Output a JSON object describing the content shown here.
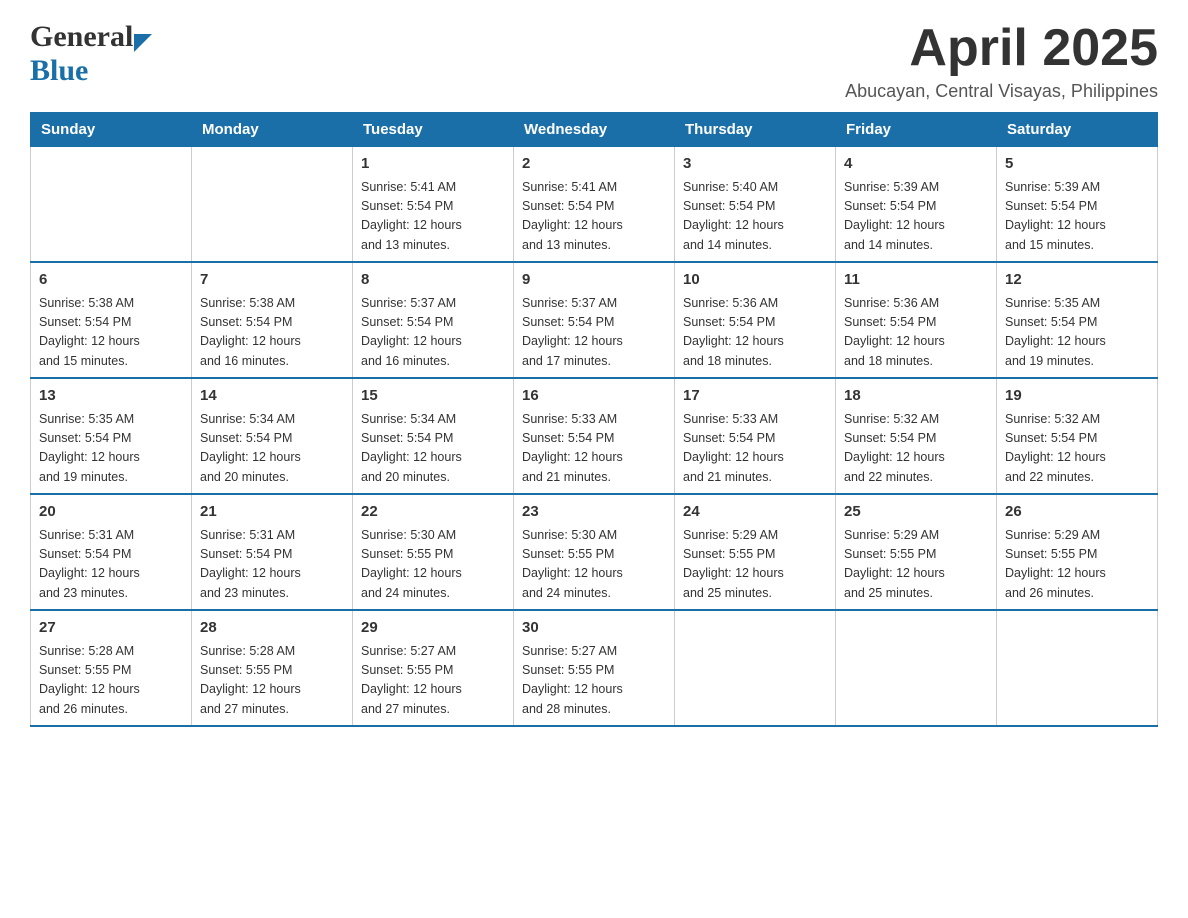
{
  "header": {
    "logo_general": "General",
    "logo_blue": "Blue",
    "title": "April 2025",
    "location": "Abucayan, Central Visayas, Philippines"
  },
  "calendar": {
    "days_of_week": [
      "Sunday",
      "Monday",
      "Tuesday",
      "Wednesday",
      "Thursday",
      "Friday",
      "Saturday"
    ],
    "weeks": [
      [
        {
          "day": "",
          "info": ""
        },
        {
          "day": "",
          "info": ""
        },
        {
          "day": "1",
          "info": "Sunrise: 5:41 AM\nSunset: 5:54 PM\nDaylight: 12 hours\nand 13 minutes."
        },
        {
          "day": "2",
          "info": "Sunrise: 5:41 AM\nSunset: 5:54 PM\nDaylight: 12 hours\nand 13 minutes."
        },
        {
          "day": "3",
          "info": "Sunrise: 5:40 AM\nSunset: 5:54 PM\nDaylight: 12 hours\nand 14 minutes."
        },
        {
          "day": "4",
          "info": "Sunrise: 5:39 AM\nSunset: 5:54 PM\nDaylight: 12 hours\nand 14 minutes."
        },
        {
          "day": "5",
          "info": "Sunrise: 5:39 AM\nSunset: 5:54 PM\nDaylight: 12 hours\nand 15 minutes."
        }
      ],
      [
        {
          "day": "6",
          "info": "Sunrise: 5:38 AM\nSunset: 5:54 PM\nDaylight: 12 hours\nand 15 minutes."
        },
        {
          "day": "7",
          "info": "Sunrise: 5:38 AM\nSunset: 5:54 PM\nDaylight: 12 hours\nand 16 minutes."
        },
        {
          "day": "8",
          "info": "Sunrise: 5:37 AM\nSunset: 5:54 PM\nDaylight: 12 hours\nand 16 minutes."
        },
        {
          "day": "9",
          "info": "Sunrise: 5:37 AM\nSunset: 5:54 PM\nDaylight: 12 hours\nand 17 minutes."
        },
        {
          "day": "10",
          "info": "Sunrise: 5:36 AM\nSunset: 5:54 PM\nDaylight: 12 hours\nand 18 minutes."
        },
        {
          "day": "11",
          "info": "Sunrise: 5:36 AM\nSunset: 5:54 PM\nDaylight: 12 hours\nand 18 minutes."
        },
        {
          "day": "12",
          "info": "Sunrise: 5:35 AM\nSunset: 5:54 PM\nDaylight: 12 hours\nand 19 minutes."
        }
      ],
      [
        {
          "day": "13",
          "info": "Sunrise: 5:35 AM\nSunset: 5:54 PM\nDaylight: 12 hours\nand 19 minutes."
        },
        {
          "day": "14",
          "info": "Sunrise: 5:34 AM\nSunset: 5:54 PM\nDaylight: 12 hours\nand 20 minutes."
        },
        {
          "day": "15",
          "info": "Sunrise: 5:34 AM\nSunset: 5:54 PM\nDaylight: 12 hours\nand 20 minutes."
        },
        {
          "day": "16",
          "info": "Sunrise: 5:33 AM\nSunset: 5:54 PM\nDaylight: 12 hours\nand 21 minutes."
        },
        {
          "day": "17",
          "info": "Sunrise: 5:33 AM\nSunset: 5:54 PM\nDaylight: 12 hours\nand 21 minutes."
        },
        {
          "day": "18",
          "info": "Sunrise: 5:32 AM\nSunset: 5:54 PM\nDaylight: 12 hours\nand 22 minutes."
        },
        {
          "day": "19",
          "info": "Sunrise: 5:32 AM\nSunset: 5:54 PM\nDaylight: 12 hours\nand 22 minutes."
        }
      ],
      [
        {
          "day": "20",
          "info": "Sunrise: 5:31 AM\nSunset: 5:54 PM\nDaylight: 12 hours\nand 23 minutes."
        },
        {
          "day": "21",
          "info": "Sunrise: 5:31 AM\nSunset: 5:54 PM\nDaylight: 12 hours\nand 23 minutes."
        },
        {
          "day": "22",
          "info": "Sunrise: 5:30 AM\nSunset: 5:55 PM\nDaylight: 12 hours\nand 24 minutes."
        },
        {
          "day": "23",
          "info": "Sunrise: 5:30 AM\nSunset: 5:55 PM\nDaylight: 12 hours\nand 24 minutes."
        },
        {
          "day": "24",
          "info": "Sunrise: 5:29 AM\nSunset: 5:55 PM\nDaylight: 12 hours\nand 25 minutes."
        },
        {
          "day": "25",
          "info": "Sunrise: 5:29 AM\nSunset: 5:55 PM\nDaylight: 12 hours\nand 25 minutes."
        },
        {
          "day": "26",
          "info": "Sunrise: 5:29 AM\nSunset: 5:55 PM\nDaylight: 12 hours\nand 26 minutes."
        }
      ],
      [
        {
          "day": "27",
          "info": "Sunrise: 5:28 AM\nSunset: 5:55 PM\nDaylight: 12 hours\nand 26 minutes."
        },
        {
          "day": "28",
          "info": "Sunrise: 5:28 AM\nSunset: 5:55 PM\nDaylight: 12 hours\nand 27 minutes."
        },
        {
          "day": "29",
          "info": "Sunrise: 5:27 AM\nSunset: 5:55 PM\nDaylight: 12 hours\nand 27 minutes."
        },
        {
          "day": "30",
          "info": "Sunrise: 5:27 AM\nSunset: 5:55 PM\nDaylight: 12 hours\nand 28 minutes."
        },
        {
          "day": "",
          "info": ""
        },
        {
          "day": "",
          "info": ""
        },
        {
          "day": "",
          "info": ""
        }
      ]
    ]
  }
}
